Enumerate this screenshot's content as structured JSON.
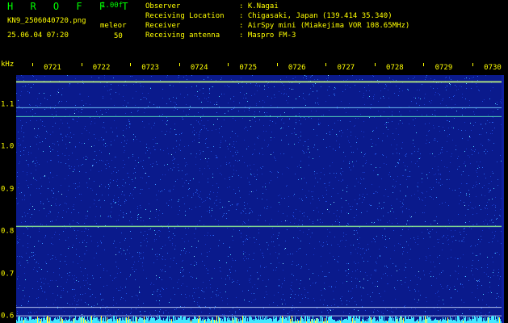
{
  "header": {
    "brand": "H R O F F T",
    "version": "1.00f",
    "filename": "KN9_2506040720.png",
    "datetime": "25.06.04 07:20",
    "mode": "meleor",
    "count": "50",
    "info": [
      {
        "label": "Observer",
        "value": ": K.Nagai"
      },
      {
        "label": "Receiving Location",
        "value": ": Chigasaki, Japan (139.414 35.340)"
      },
      {
        "label": "Receiver",
        "value": ": AirSpy mini (Miakejima VOR 108.65MHz)"
      },
      {
        "label": "Receiving antenna",
        "value": ": Maspro FM-3"
      }
    ]
  },
  "spectrogram": {
    "y_unit": "kHz",
    "y_ticks": [
      "1.1",
      "1.0",
      "0.9",
      "0.8",
      "0.7",
      "0.6"
    ],
    "y_range": [
      0.585,
      1.17
    ],
    "time_labels": [
      "0721",
      "0722",
      "0723",
      "0724",
      "0725",
      "0726",
      "0727",
      "0728",
      "0729",
      "0730"
    ],
    "colors": {
      "background": "#0a1a8c",
      "noise_low": "#1838c8",
      "noise_high": "#4fd0ff",
      "carrier": "#c8ff80",
      "text": "#ffff00",
      "brand": "#00ff00"
    },
    "signals_khz": [
      1.154,
      1.093,
      1.072,
      0.813,
      0.622,
      0.602
    ]
  }
}
